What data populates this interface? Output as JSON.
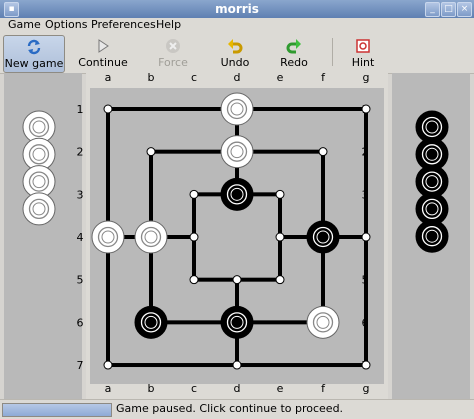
{
  "window": {
    "title": "morris"
  },
  "menu": [
    "Game",
    "Options",
    "Preferences",
    "Help"
  ],
  "toolbar": {
    "new_game": "New game",
    "continue_game": "Continue game",
    "force_move": "Force move",
    "undo_move": "Undo move",
    "redo_move": "Redo move",
    "hint": "Hint"
  },
  "board": {
    "columns": [
      "a",
      "b",
      "c",
      "d",
      "e",
      "f",
      "g"
    ],
    "rows": [
      "1",
      "2",
      "3",
      "4",
      "5",
      "6",
      "7"
    ],
    "pieces": [
      {
        "color": "white",
        "pos": "d1"
      },
      {
        "color": "white",
        "pos": "d2"
      },
      {
        "color": "black",
        "pos": "d3"
      },
      {
        "color": "white",
        "pos": "a4"
      },
      {
        "color": "white",
        "pos": "b4"
      },
      {
        "color": "black",
        "pos": "f4"
      },
      {
        "color": "black",
        "pos": "b6"
      },
      {
        "color": "black",
        "pos": "d6"
      },
      {
        "color": "white",
        "pos": "f6"
      }
    ],
    "reserve": {
      "white": 4,
      "black": 5
    }
  },
  "status": {
    "text": "Game paused. Click continue to proceed."
  },
  "colors": {
    "board_bg": "#b9b9b9",
    "title_bar": "#6f8fc0"
  }
}
